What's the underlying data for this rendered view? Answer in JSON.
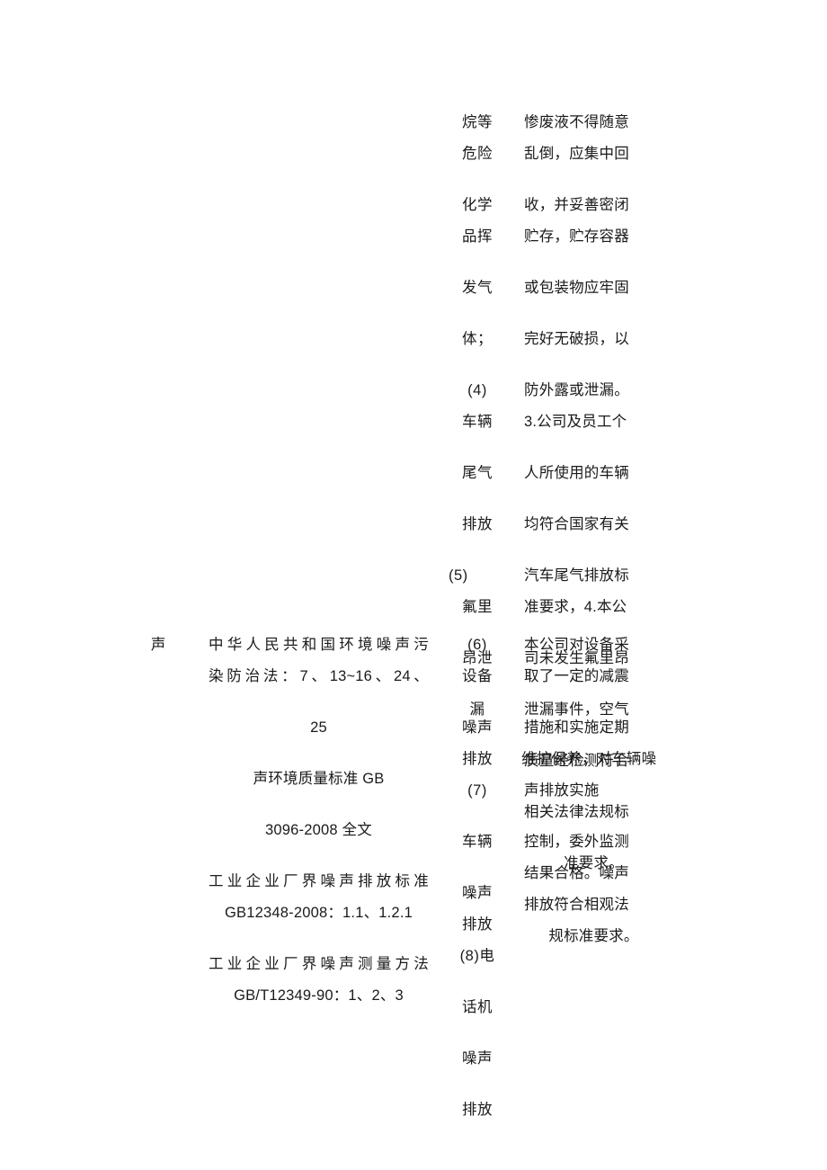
{
  "document": {
    "type": "environmental-compliance-table",
    "page_background": "#ffffff",
    "text_color": "#1a1a1a"
  },
  "air_section": {
    "items_column": {
      "groups": [
        {
          "lines": [
            "烷等",
            "危险"
          ]
        },
        {
          "lines": [
            "化学",
            "品挥"
          ]
        },
        {
          "lines": [
            "发气"
          ]
        },
        {
          "lines": [
            "体；"
          ]
        },
        {
          "lines": [
            "(4)",
            "车辆"
          ]
        },
        {
          "lines": [
            "尾气"
          ]
        },
        {
          "lines": [
            "排放"
          ]
        },
        {
          "lines": [
            "(5)",
            "氟里"
          ]
        },
        {
          "lines": [
            "昂泄"
          ]
        },
        {
          "lines": [
            "漏"
          ]
        }
      ]
    },
    "description_column": {
      "groups": [
        {
          "lines": [
            "惨废液不得随意",
            "乱倒，应集中回"
          ]
        },
        {
          "lines": [
            "收，并妥善密闭",
            "贮存，贮存容器"
          ]
        },
        {
          "lines": [
            "或包装物应牢固"
          ]
        },
        {
          "lines": [
            "完好无破损，以"
          ]
        },
        {
          "lines": [
            "防外露或泄漏。",
            "3.公司及员工个"
          ]
        },
        {
          "lines": [
            "人所使用的车辆"
          ]
        },
        {
          "lines": [
            "均符合国家有关"
          ]
        },
        {
          "lines": [
            "汽车尾气排放标",
            "准要求，4.本公"
          ]
        },
        {
          "lines": [
            "司未发生氟里昂"
          ]
        },
        {
          "lines": [
            "泄漏事件，空气"
          ]
        },
        {
          "lines": [
            "质量经检测符合"
          ]
        },
        {
          "lines": [
            "相关法律法规标"
          ]
        },
        {
          "lines": [
            "准要求。"
          ],
          "align": "center"
        }
      ]
    }
  },
  "noise_section": {
    "category_label": "声",
    "standards_column": {
      "groups": [
        {
          "lines": [
            "中华人民共和国环境噪声污",
            "染防治法：7、13~16、24、"
          ],
          "align": "justify"
        },
        {
          "lines": [
            "25"
          ],
          "align": "center"
        },
        {
          "lines": [
            "声环境质量标准 GB"
          ],
          "align": "center"
        },
        {
          "lines": [
            "3096-2008 全文"
          ],
          "align": "center"
        },
        {
          "lines": [
            "工业企业厂界噪声排放标准"
          ],
          "align": "justify"
        },
        {
          "lines": [
            "GB12348-2008：1.1、1.2.1"
          ],
          "align": "center"
        },
        {
          "lines": [
            "工业企业厂界噪声测量方法"
          ],
          "align": "justify"
        },
        {
          "lines": [
            "GB/T12349-90：1、2、3"
          ],
          "align": "center"
        }
      ]
    },
    "items_column": {
      "groups": [
        {
          "lines": [
            "(6)",
            "设备"
          ]
        },
        {
          "lines": [
            "噪声"
          ]
        },
        {
          "lines": [
            "排放"
          ]
        },
        {
          "lines": [
            "(7)"
          ]
        },
        {
          "lines": [
            "车辆"
          ]
        },
        {
          "lines": [
            "噪声"
          ]
        },
        {
          "lines": [
            "排放"
          ]
        },
        {
          "lines": [
            "(8)电"
          ]
        },
        {
          "lines": [
            "话机"
          ]
        },
        {
          "lines": [
            "噪声"
          ]
        },
        {
          "lines": [
            "排放"
          ]
        }
      ]
    },
    "description_column": {
      "groups": [
        {
          "lines": [
            "本公司对设备采",
            "取了一定的减震"
          ]
        },
        {
          "lines": [
            "措施和实施定期"
          ]
        },
        {
          "lines": [
            "维护保养，对车辆噪"
          ]
        },
        {
          "lines": [
            "声排放实施"
          ]
        },
        {
          "lines": [
            "控制，委外监测"
          ]
        },
        {
          "lines": [
            "结果合格。噪声"
          ]
        },
        {
          "lines": [
            "排放符合相观法"
          ]
        },
        {
          "lines": [
            "规标准要求。"
          ],
          "align": "center"
        }
      ]
    }
  }
}
